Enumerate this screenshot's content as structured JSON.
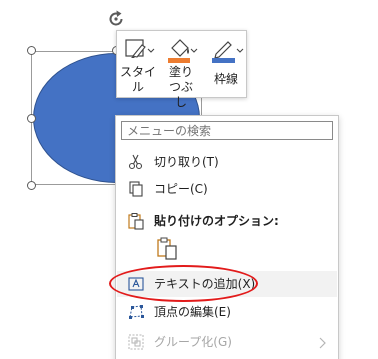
{
  "mini_toolbar": {
    "style_label": "スタイル",
    "fill_label": "塗りつぶし",
    "outline_label": "枠線",
    "colors": {
      "fill_accent": "#ed7d31",
      "outline_accent": "#4472c4"
    }
  },
  "context_menu": {
    "search_placeholder": "メニューの検索",
    "items": [
      {
        "label": "切り取り(T)",
        "icon": "scissors-icon"
      },
      {
        "label": "コピー(C)",
        "icon": "copy-icon"
      },
      {
        "label": "貼り付けのオプション:",
        "icon": "paste-icon"
      },
      {
        "label": "テキストの追加(X)",
        "icon": "text-box-icon"
      },
      {
        "label": "頂点の編集(E)",
        "icon": "edit-points-icon"
      },
      {
        "label": "グループ化(G)",
        "icon": "group-icon"
      }
    ]
  },
  "shape": {
    "fill_color": "#4472c4"
  },
  "annotation": {
    "color": "#e21b1b"
  }
}
